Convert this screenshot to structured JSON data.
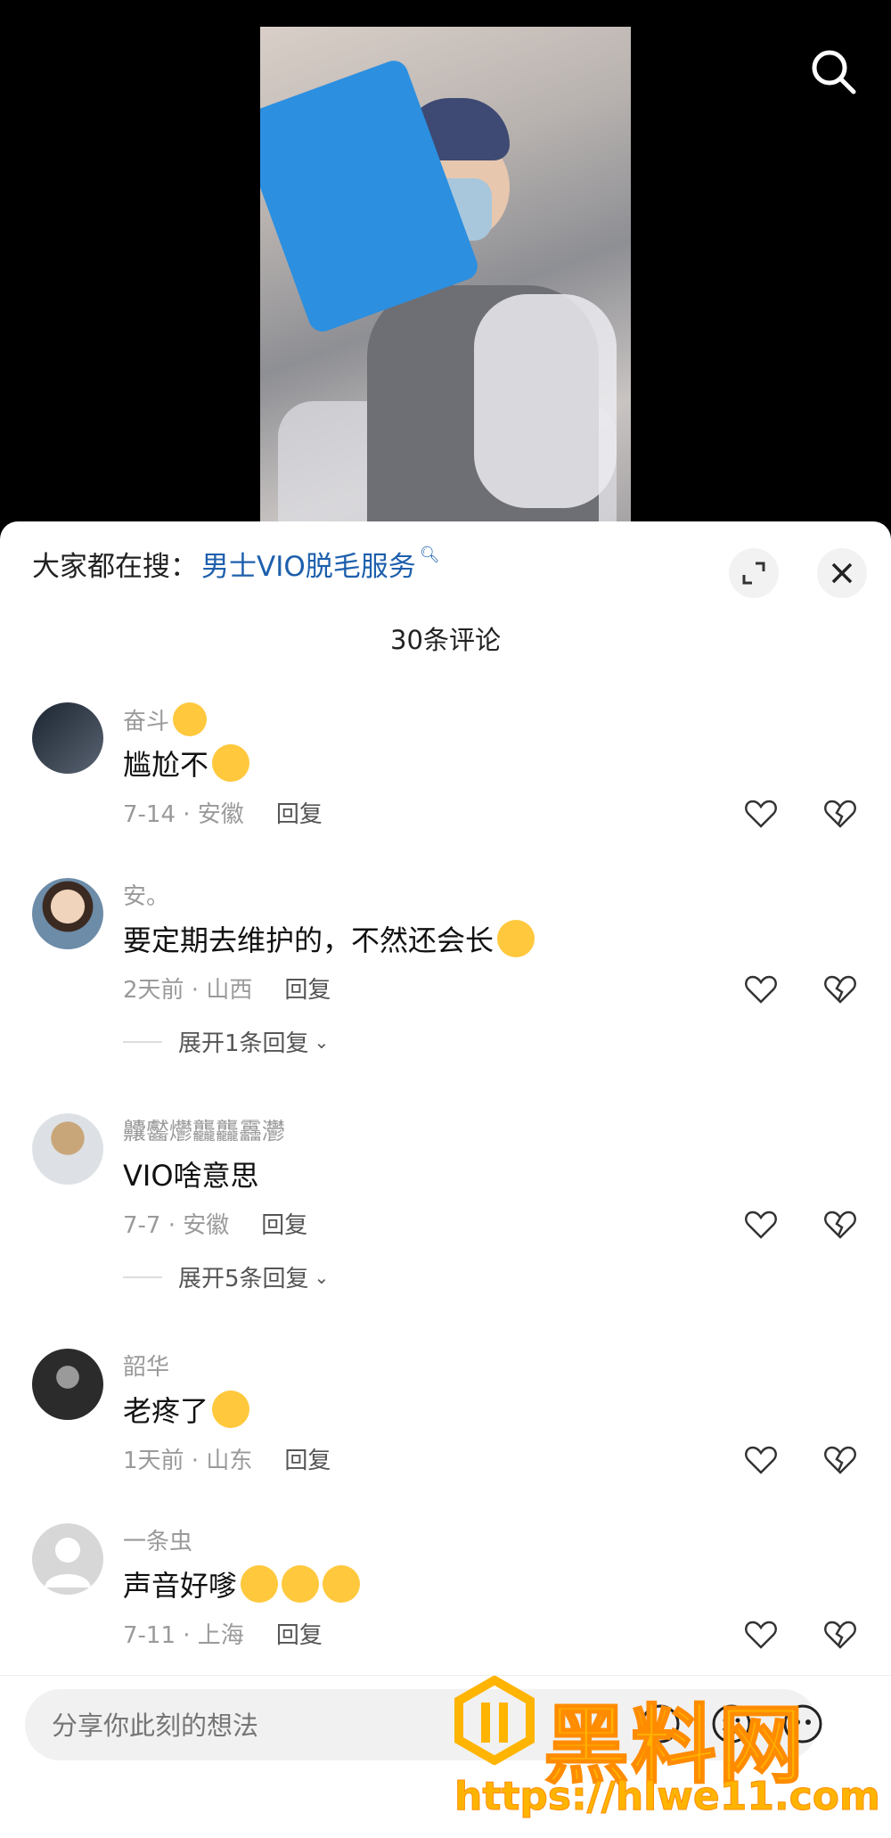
{
  "trending": {
    "prefix": "大家都在搜：",
    "query": "男士VIO脱毛服务"
  },
  "comments_count": "30条评论",
  "comments": [
    {
      "user": "奋斗",
      "user_emoji": "kissing-heart-emoji",
      "text": "尴尬不",
      "text_emoji": "tears-of-joy-emoji",
      "meta": "7-14 · 安徽",
      "reply": "回复"
    },
    {
      "user": "安。",
      "text": "要定期去维护的，不然还会长",
      "text_emoji": "tears-of-joy-emoji",
      "meta": "2天前 · 山西",
      "reply": "回复",
      "expand": "展开1条回复"
    },
    {
      "user": "齉齾爩龘龘靐灪",
      "text": "VIO啥意思",
      "meta": "7-7 · 安徽",
      "reply": "回复",
      "expand": "展开5条回复"
    },
    {
      "user": "韶华",
      "text": "老疼了",
      "text_emoji": "crying-emoji",
      "meta": "1天前 · 山东",
      "reply": "回复"
    },
    {
      "user": "一条虫",
      "text": "声音好嗲",
      "text_emoji": "heart-eyes-emoji ×3",
      "meta": "7-11 · 上海",
      "reply": "回复"
    }
  ],
  "input": {
    "placeholder": "分享你此刻的想法"
  },
  "watermark": {
    "text": "黑料网",
    "url": "https://hlwe11.com"
  },
  "colors": {
    "link": "#1d5fad",
    "watermark": "#ffb400"
  }
}
